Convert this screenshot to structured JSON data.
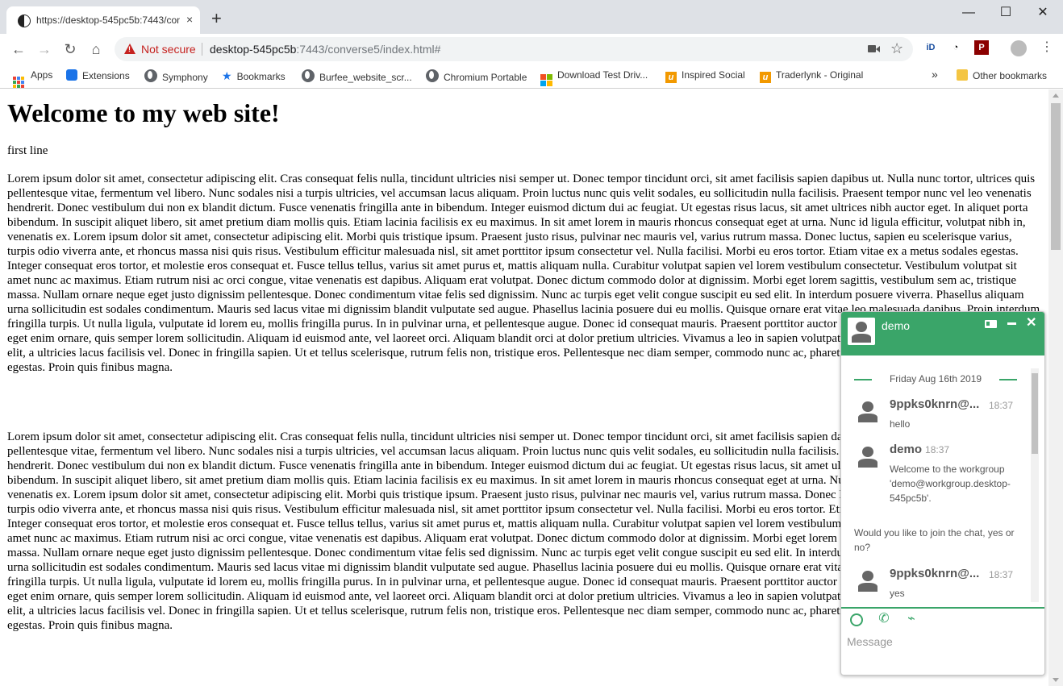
{
  "browser": {
    "tab": {
      "title": "https://desktop-545pc5b:7443/converse5/index.html#",
      "close": "×"
    },
    "new_tab": "+",
    "window": {
      "minimize": "—",
      "maximize": "☐",
      "close": "✕"
    },
    "address": {
      "security_label": "Not secure",
      "host": "desktop-545pc5b",
      "path": ":7443/converse5/index.html#"
    },
    "extensions": [
      {
        "label": "iD",
        "color": "#1a4fa0"
      },
      {
        "label": "◔",
        "color": "#e8710a"
      },
      {
        "label": "P",
        "color": "#8b0000"
      }
    ],
    "bookmarks": [
      {
        "label": "Apps"
      },
      {
        "label": "Extensions"
      },
      {
        "label": "Symphony"
      },
      {
        "label": "Bookmarks"
      },
      {
        "label": "Burfee_website_scr..."
      },
      {
        "label": "Chromium Portable"
      },
      {
        "label": "Download Test Driv..."
      },
      {
        "label": "Inspired Social"
      },
      {
        "label": "Traderlynk - Original"
      }
    ],
    "bookmarks_overflow": "»",
    "other_bookmarks": "Other bookmarks"
  },
  "page": {
    "heading": "Welcome to my web site!",
    "first_line": "first line",
    "paragraph": "Lorem ipsum dolor sit amet, consectetur adipiscing elit. Cras consequat felis nulla, tincidunt ultricies nisi semper ut. Donec tempor tincidunt orci, sit amet facilisis sapien dapibus ut. Nulla nunc tortor, ultrices quis pellentesque vitae, fermentum vel libero. Nunc sodales nisi a turpis ultricies, vel accumsan lacus aliquam. Proin luctus nunc quis velit sodales, eu sollicitudin nulla facilisis. Praesent tempor nunc vel leo venenatis hendrerit. Donec vestibulum dui non ex blandit dictum. Fusce venenatis fringilla ante in bibendum. Integer euismod dictum dui ac feugiat. Ut egestas risus lacus, sit amet ultrices nibh auctor eget. In aliquet porta bibendum. In suscipit aliquet libero, sit amet pretium diam mollis quis. Etiam lacinia facilisis ex eu maximus. In sit amet lorem in mauris rhoncus consequat eget at urna. Nunc id ligula efficitur, volutpat nibh in, venenatis ex. Lorem ipsum dolor sit amet, consectetur adipiscing elit. Morbi quis tristique ipsum. Praesent justo risus, pulvinar nec mauris vel, varius rutrum massa. Donec luctus, sapien eu scelerisque varius, turpis odio viverra ante, et rhoncus massa nisi quis risus. Vestibulum efficitur malesuada nisl, sit amet porttitor ipsum consectetur vel. Nulla facilisi. Morbi eu eros tortor. Etiam vitae ex a metus sodales egestas. Integer consequat eros tortor, et molestie eros consequat et. Fusce tellus tellus, varius sit amet purus et, mattis aliquam nulla. Curabitur volutpat sapien vel lorem vestibulum consectetur. Vestibulum volutpat sit amet nunc ac maximus. Etiam rutrum nisi ac orci congue, vitae venenatis est dapibus. Aliquam erat volutpat. Donec dictum commodo dolor at dignissim. Morbi eget lorem sagittis, vestibulum sem ac, tristique massa. Nullam ornare neque eget justo dignissim pellentesque. Donec condimentum vitae felis sed dignissim. Nunc ac turpis eget velit congue suscipit eu sed elit. In interdum posuere viverra. Phasellus aliquam urna sollicitudin est sodales condimentum. Mauris sed lacus vitae mi dignissim blandit vulputate sed augue. Phasellus lacinia posuere dui eu mollis. Quisque ornare erat vitae leo malesuada dapibus. Proin interdum fringilla turpis. Ut nulla ligula, vulputate id lorem eu, mollis fringilla purus. In in pulvinar urna, et pellentesque augue. Donec id consequat mauris. Praesent porttitor auctor lacus ut blandit. Nullam porta mauris eget enim ornare, quis semper lorem sollicitudin. Aliquam id euismod ante, vel laoreet orci. Aliquam blandit orci at dolor pretium ultricies. Vivamus a leo in sapien volutpat volutpat non ut tortor. Sed varius sem elit, a ultricies lacus facilisis vel. Donec in fringilla sapien. Ut et tellus scelerisque, rutrum felis non, tristique eros. Pellentesque nec diam semper, commodo nunc ac, pharetra urna. Sed feugiat quam vel interdum egestas. Proin quis finibus magna."
  },
  "chat": {
    "contact_name": "demo",
    "accent_color": "#3aa569",
    "date_separator": "Friday Aug 16th 2019",
    "messages": [
      {
        "author": "9ppks0knrn@...",
        "time": "18:37",
        "text": "hello"
      },
      {
        "author": "demo",
        "time": "18:37",
        "text": "Welcome to the workgroup 'demo@workgroup.desktop-545pc5b'.",
        "continuation": "Would you like to join the chat, yes or no?"
      },
      {
        "author": "9ppks0knrn@...",
        "time": "18:37",
        "text": "yes"
      }
    ],
    "input_placeholder": "Message"
  }
}
